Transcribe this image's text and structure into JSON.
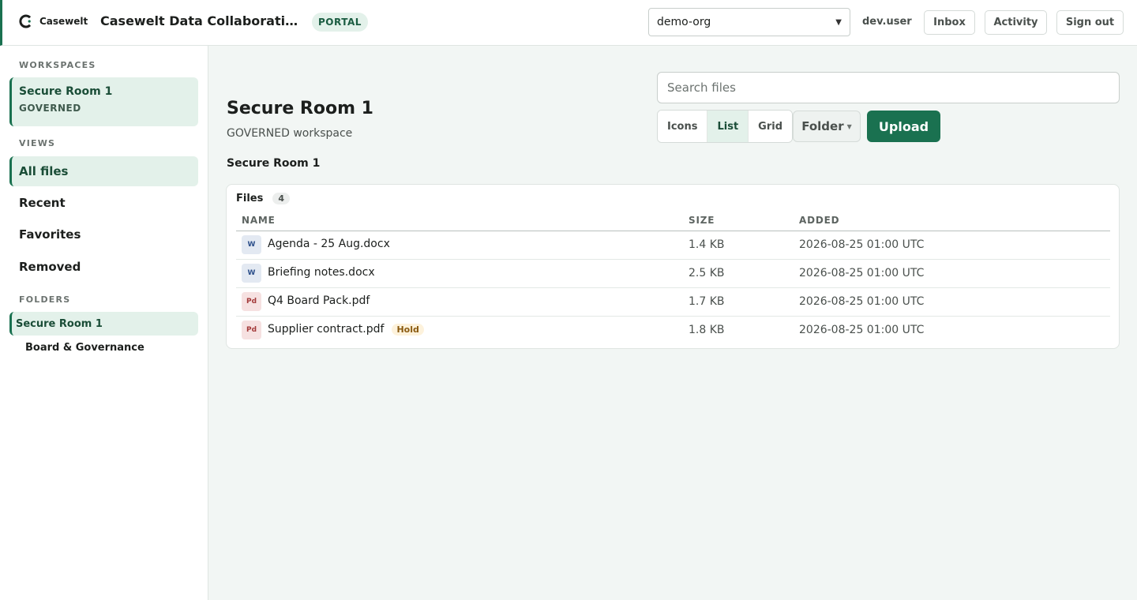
{
  "header": {
    "logo_text": "Casewelt",
    "app_title": "Casewelt Data Collaboration Portal",
    "portal_badge": "PORTAL",
    "org_selected": "demo-org",
    "user": "dev.user",
    "inbox_label": "Inbox",
    "activity_label": "Activity",
    "signout_label": "Sign out",
    "accent_color": "#1a7150"
  },
  "sidebar": {
    "workspaces_heading": "WORKSPACES",
    "workspace": {
      "name": "Secure Room 1",
      "type": "GOVERNED"
    },
    "views_heading": "VIEWS",
    "views": [
      {
        "label": "All files",
        "active": true
      },
      {
        "label": "Recent",
        "active": false
      },
      {
        "label": "Favorites",
        "active": false
      },
      {
        "label": "Removed",
        "active": false
      }
    ],
    "folders_heading": "FOLDERS",
    "folders": [
      {
        "label": "Secure Room 1",
        "active": true
      },
      {
        "label": "Board & Governance",
        "active": false
      }
    ]
  },
  "main": {
    "title": "Secure Room 1",
    "subtitle": "GOVERNED workspace",
    "breadcrumb": "Secure Room 1",
    "search_placeholder": "Search files",
    "view_modes": [
      {
        "label": "Icons",
        "active": false
      },
      {
        "label": "List",
        "active": true
      },
      {
        "label": "Grid",
        "active": false
      }
    ],
    "folder_button": "Folder",
    "upload_button": "Upload",
    "files": {
      "heading": "Files",
      "count": "4",
      "columns": {
        "name": "NAME",
        "size": "SIZE",
        "added": "ADDED"
      },
      "rows": [
        {
          "icon": "W",
          "icon_type": "word",
          "name": "Agenda - 25 Aug.docx",
          "badge": "",
          "size": "1.4 KB",
          "added": "2026-08-25 01:00 UTC"
        },
        {
          "icon": "W",
          "icon_type": "word",
          "name": "Briefing notes.docx",
          "badge": "",
          "size": "2.5 KB",
          "added": "2026-08-25 01:00 UTC"
        },
        {
          "icon": "Pd",
          "icon_type": "pdf",
          "name": "Q4 Board Pack.pdf",
          "badge": "",
          "size": "1.7 KB",
          "added": "2026-08-25 01:00 UTC"
        },
        {
          "icon": "Pd",
          "icon_type": "pdf",
          "name": "Supplier contract.pdf",
          "badge": "Hold",
          "size": "1.8 KB",
          "added": "2026-08-25 01:00 UTC"
        }
      ]
    }
  }
}
